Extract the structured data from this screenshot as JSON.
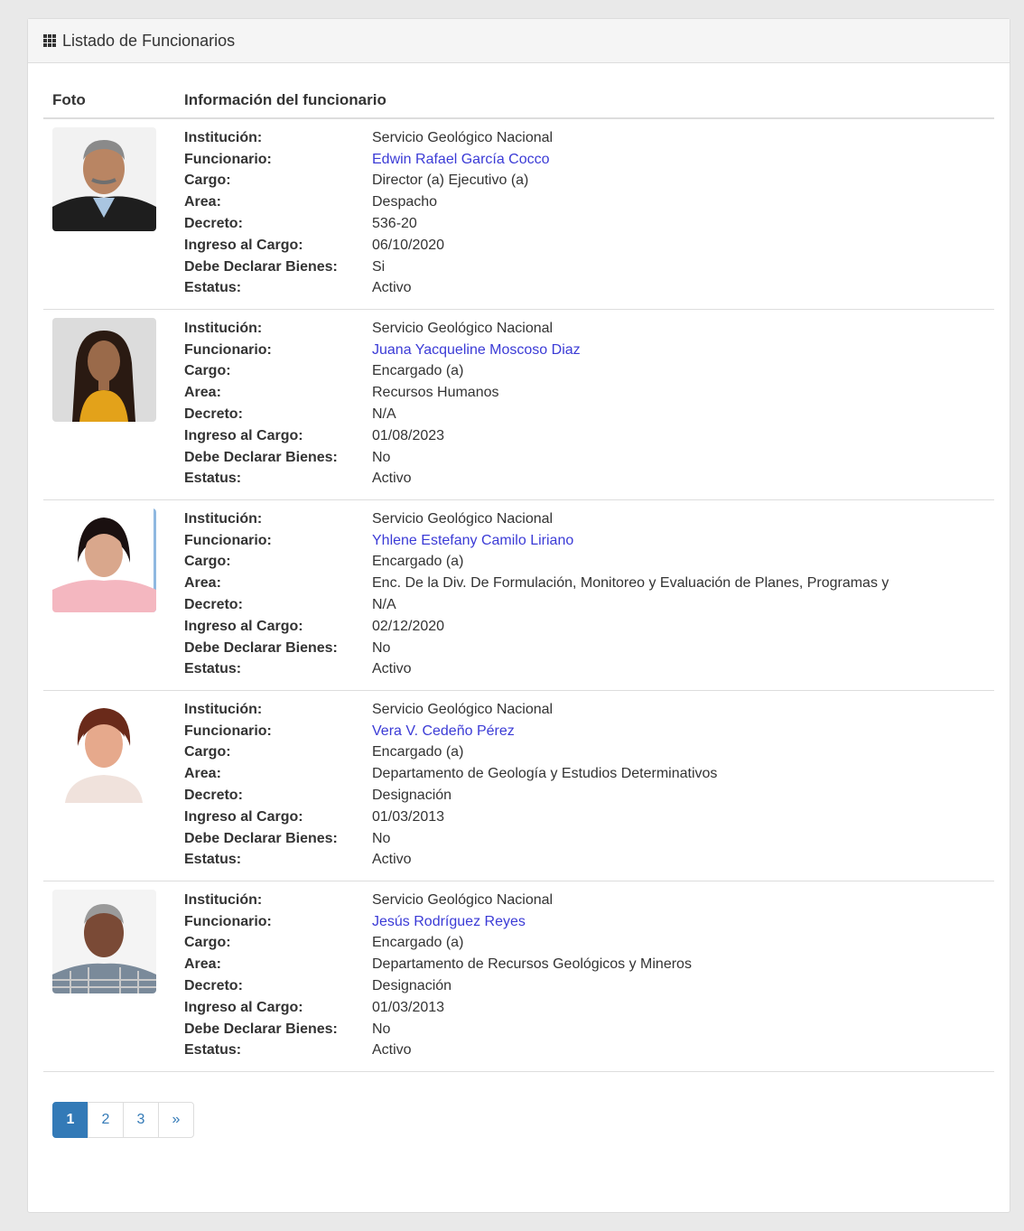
{
  "panel": {
    "title": "Listado de Funcionarios",
    "icon": "grid-icon"
  },
  "table": {
    "headers": {
      "photo": "Foto",
      "info": "Información del funcionario"
    },
    "labels": {
      "institucion": "Institución:",
      "funcionario": "Funcionario:",
      "cargo": "Cargo:",
      "area": "Area:",
      "decreto": "Decreto:",
      "ingreso": "Ingreso al Cargo:",
      "declarar": "Debe Declarar Bienes:",
      "estatus": "Estatus:"
    },
    "rows": [
      {
        "institucion": "Servicio Geológico Nacional",
        "funcionario": "Edwin Rafael García Cocco",
        "cargo": "Director (a) Ejecutivo (a)",
        "area": "Despacho",
        "decreto": "536-20",
        "ingreso": "06/10/2020",
        "declarar": "Si",
        "estatus": "Activo"
      },
      {
        "institucion": "Servicio Geológico Nacional",
        "funcionario": "Juana Yacqueline Moscoso Diaz",
        "cargo": "Encargado (a)",
        "area": "Recursos Humanos",
        "decreto": "N/A",
        "ingreso": "01/08/2023",
        "declarar": "No",
        "estatus": "Activo"
      },
      {
        "institucion": "Servicio Geológico Nacional",
        "funcionario": "Yhlene Estefany Camilo Liriano",
        "cargo": "Encargado (a)",
        "area": "Enc. De la Div. De Formulación, Monitoreo y Evaluación de Planes, Programas y",
        "decreto": "N/A",
        "ingreso": "02/12/2020",
        "declarar": "No",
        "estatus": "Activo"
      },
      {
        "institucion": "Servicio Geológico Nacional",
        "funcionario": "Vera V. Cedeño Pérez",
        "cargo": "Encargado (a)",
        "area": "Departamento de Geología y Estudios Determinativos",
        "decreto": "Designación",
        "ingreso": "01/03/2013",
        "declarar": "No",
        "estatus": "Activo"
      },
      {
        "institucion": "Servicio Geológico Nacional",
        "funcionario": "Jesús Rodríguez Reyes",
        "cargo": "Encargado (a)",
        "area": "Departamento de Recursos Geológicos y Mineros",
        "decreto": "Designación",
        "ingreso": "01/03/2013",
        "declarar": "No",
        "estatus": "Activo"
      }
    ]
  },
  "pagination": {
    "pages": [
      "1",
      "2",
      "3"
    ],
    "next": "»",
    "active": "1"
  },
  "colors": {
    "link": "#3b3bd6",
    "accent": "#337ab7"
  }
}
